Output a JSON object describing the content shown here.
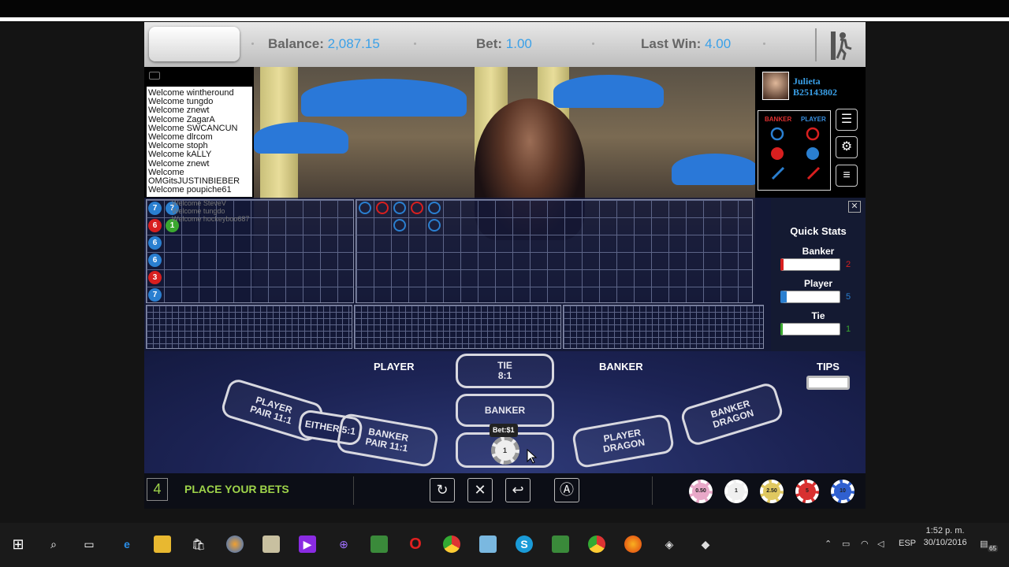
{
  "header": {
    "balance_label": "Balance:",
    "balance_value": "2,087.15",
    "bet_label": "Bet:",
    "bet_value": "1.00",
    "last_win_label": "Last Win:",
    "last_win_value": "4.00"
  },
  "chat": {
    "lines": [
      "Welcome wintheround",
      "Welcome tungdo",
      "Welcome znewt",
      "Welcome ZagarA",
      "Welcome SWCANCUN",
      "Welcome dlrcom",
      "Welcome stoph",
      "Welcome kALLY",
      "Welcome znewt",
      "Welcome",
      "OMGitsJUSTINBIEBER",
      "Welcome poupiche61"
    ],
    "faded_lines": [
      "Welcome SteveV",
      "Welcome tungdo",
      "Welcome hockeyboo687"
    ]
  },
  "user": {
    "name": "Julieta",
    "id": "B25143802"
  },
  "legend": {
    "banker": "BANKER",
    "player": "PLAYER"
  },
  "bead_road": [
    {
      "col": 0,
      "row": 0,
      "v": "7",
      "c": "#2a7fd0"
    },
    {
      "col": 1,
      "row": 0,
      "v": "7",
      "c": "#2a7fd0"
    },
    {
      "col": 0,
      "row": 1,
      "v": "6",
      "c": "#d81f1f"
    },
    {
      "col": 1,
      "row": 1,
      "v": "1",
      "c": "#3aa82f"
    },
    {
      "col": 0,
      "row": 2,
      "v": "6",
      "c": "#2a7fd0"
    },
    {
      "col": 0,
      "row": 3,
      "v": "6",
      "c": "#2a7fd0"
    },
    {
      "col": 0,
      "row": 4,
      "v": "3",
      "c": "#d81f1f"
    },
    {
      "col": 0,
      "row": 5,
      "v": "7",
      "c": "#2a7fd0"
    }
  ],
  "big_road": [
    {
      "col": 0,
      "row": 0,
      "c": "#2a7fd0"
    },
    {
      "col": 1,
      "row": 0,
      "c": "#d81f1f"
    },
    {
      "col": 2,
      "row": 0,
      "c": "#2a7fd0"
    },
    {
      "col": 2,
      "row": 1,
      "c": "#2a7fd0"
    },
    {
      "col": 3,
      "row": 0,
      "c": "#d81f1f"
    },
    {
      "col": 4,
      "row": 0,
      "c": "#2a7fd0"
    },
    {
      "col": 4,
      "row": 1,
      "c": "#2a7fd0"
    }
  ],
  "quick_stats": {
    "title": "Quick Stats",
    "banker_label": "Banker",
    "banker_count": "2",
    "player_label": "Player",
    "player_count": "5",
    "tie_label": "Tie",
    "tie_count": "1"
  },
  "table": {
    "player": "PLAYER",
    "banker": "BANKER",
    "tips": "TIPS",
    "tie": "TIE",
    "tie_odds": "8:1",
    "banker_spot": "BANKER",
    "player_pair": "PLAYER PAIR 11:1",
    "either": "EITHER 5:1",
    "banker_pair": "BANKER PAIR 11:1",
    "player_dragon": "PLAYER DRAGON",
    "banker_dragon": "BANKER DRAGON",
    "bet_tooltip": "Bet:$1",
    "placed_chip": "1"
  },
  "bottom": {
    "timer": "4",
    "status": "PLACE YOUR BETS",
    "chips": [
      {
        "label": "0.50",
        "color": "#e8a8c8"
      },
      {
        "label": "1",
        "color": "#f0f0f0"
      },
      {
        "label": "2.50",
        "color": "#e0c860"
      },
      {
        "label": "5",
        "color": "#d83030"
      },
      {
        "label": "10",
        "color": "#3060d0"
      }
    ]
  },
  "taskbar": {
    "lang": "ESP",
    "time": "1:52 p. m.",
    "date": "30/10/2016",
    "notif_count": "65"
  }
}
